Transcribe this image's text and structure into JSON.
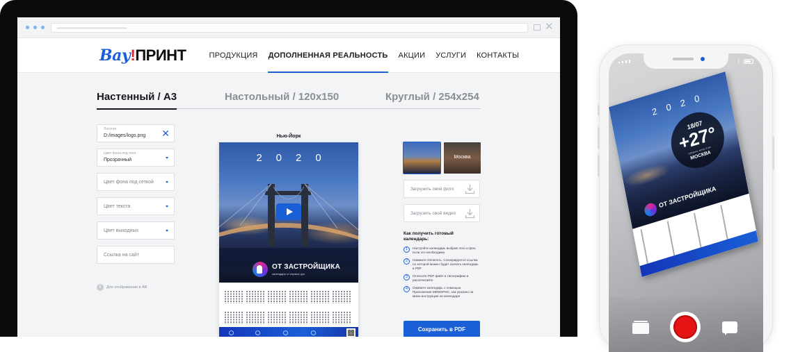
{
  "brand": {
    "part1": "Вау",
    "part2": "!",
    "part3": "ПРИНТ"
  },
  "nav": [
    {
      "label": "ПРОДУКЦИЯ",
      "active": false
    },
    {
      "label": "ДОПОЛНЕННАЯ РЕАЛЬНОСТЬ",
      "active": true
    },
    {
      "label": "АКЦИИ",
      "active": false
    },
    {
      "label": "УСЛУГИ",
      "active": false
    },
    {
      "label": "КОНТАКТЫ",
      "active": false
    }
  ],
  "tabs": [
    {
      "label": "Настенный / А3",
      "active": true
    },
    {
      "label": "Настольный / 120х150",
      "active": false
    },
    {
      "label": "Круглый / 254х254",
      "active": false
    }
  ],
  "form": {
    "logo": {
      "label": "Логотип",
      "value": "D:/images/logo.png"
    },
    "bg_logo": {
      "label": "Цвет фона под лого",
      "value": "Прозрачный"
    },
    "bg_grid": {
      "placeholder": "Цвет фона под сеткой"
    },
    "text_color": {
      "placeholder": "Цвет текста"
    },
    "weekend_color": {
      "placeholder": "Цвет выходных"
    },
    "site_link": {
      "placeholder": "Ссылка на сайт"
    },
    "hint": "Для отображения в AR"
  },
  "preview": {
    "title": "Нью-Йорк",
    "year": "2020",
    "developer_name": "ОТ ЗАСТРОЙЩИКА",
    "developer_sub": "календари от первых рук"
  },
  "backgrounds": [
    {
      "label": "",
      "selected": true
    },
    {
      "label": "Москва",
      "selected": false
    }
  ],
  "uploads": {
    "photo": "Загрузить свой фото",
    "video": "Загрузить свой видео"
  },
  "howto": {
    "title": "Как получить готовый календарь:",
    "steps": [
      {
        "num": "1",
        "text": "Настройте календарь выбрав лого и фон, если это необходимо"
      },
      {
        "num": "2",
        "text": "Нажмите Оплатить. Сгенерируется ссылка по которой можно будет скачать календарь в PDF"
      },
      {
        "num": "3",
        "text": "Отнесите PDF файл в типографию и распечатайте"
      },
      {
        "num": "4",
        "text": "Оживите календарь с помощью Приложения МЕМОРИС, как указано на мини-инструкции на календаре"
      }
    ]
  },
  "save_button": "Сохранить в PDF",
  "phone": {
    "weather_date": "18/07",
    "weather_temp": "+27°",
    "weather_city": "МОСКВА",
    "weather_sub": "Облачно, ветер 3 м/с",
    "year": "2020",
    "developer_name": "ОТ ЗАСТРОЙЩИКА"
  },
  "colors": {
    "accent": "#1a5fd6",
    "record": "#e41414",
    "dark": "#0b0b0d"
  }
}
